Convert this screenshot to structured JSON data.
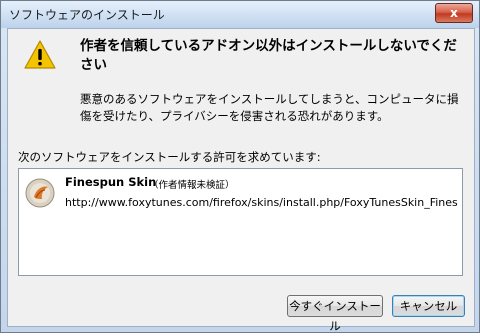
{
  "window": {
    "title": "ソフトウェアのインストール"
  },
  "titlebar": {
    "close_glyph": "x"
  },
  "warning": {
    "headline": "作者を信頼しているアドオン以外はインストールしないでください",
    "body": "悪意のあるソフトウェアをインストールしてしまうと、コンピュータに損傷を受けたり、プライバシーを侵害される恐れがあります。"
  },
  "list": {
    "label": "次のソフトウェアをインストールする許可を求めています:",
    "items": [
      {
        "name": "Finespun Skin",
        "note": "（作者情報未検証）",
        "url": "http://www.foxytunes.com/firefox/skins/install.php/FoxyTunesSkin_Finespun"
      }
    ]
  },
  "buttons": {
    "install_label": "今すぐインストール",
    "cancel_label": "キャンセル"
  },
  "icons": {
    "warning": "warning-triangle-icon",
    "addon": "addon-skin-icon"
  }
}
